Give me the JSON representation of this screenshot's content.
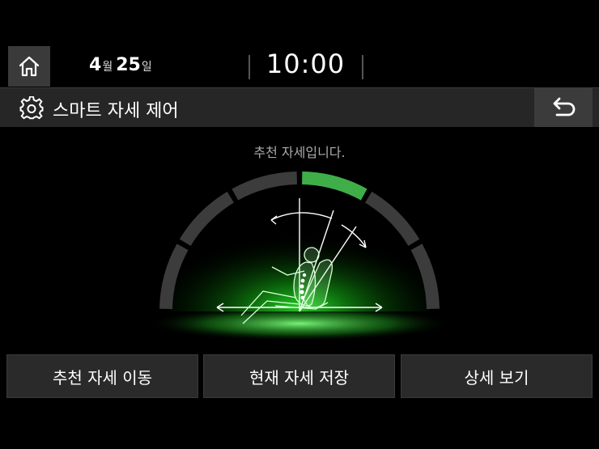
{
  "status": {
    "date_month": "4",
    "date_month_unit": "월",
    "date_day": "25",
    "date_day_unit": "일",
    "time": "10:00"
  },
  "header": {
    "title": "스마트 자세 제어"
  },
  "main": {
    "message": "추천 자세입니다.",
    "gauge": {
      "segments": 6,
      "active_segment": 4,
      "active_color": "#3fae49"
    }
  },
  "actions": [
    {
      "label": "추천 자세 이동"
    },
    {
      "label": "현재 자세 저장"
    },
    {
      "label": "상세 보기"
    }
  ],
  "icons": {
    "home": "home-icon",
    "settings": "gear-icon",
    "back": "back-arrow-icon"
  }
}
